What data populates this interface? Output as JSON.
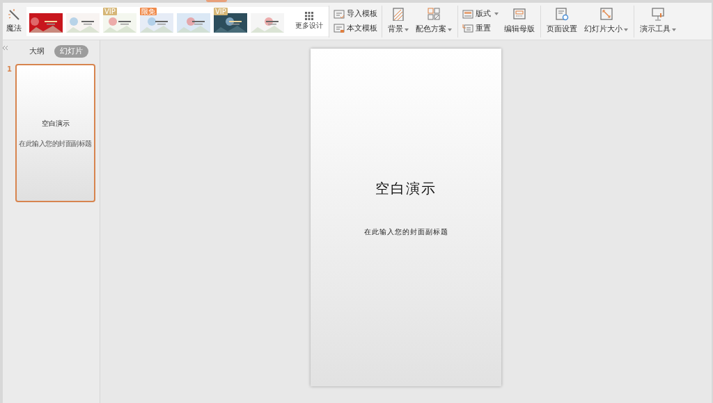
{
  "toolbar": {
    "magic": {
      "label": "魔法"
    },
    "templates": [
      {
        "kind": "picture",
        "color": "#c8161d"
      },
      {
        "kind": "picture",
        "color": "#f8f4f2"
      },
      {
        "kind": "picture",
        "color": "#f4f7ef",
        "badge": "VIP"
      },
      {
        "kind": "picture",
        "color": "#e6ecf6",
        "badge": "限免"
      },
      {
        "kind": "picture",
        "color": "#dbe8f5"
      },
      {
        "kind": "picture",
        "color": "#2d4e5c",
        "badge": "VIP"
      },
      {
        "kind": "picture",
        "color": "#f5f5f5"
      }
    ],
    "more_designs": "更多设计",
    "groups": [
      [
        {
          "kind": "small",
          "label": "导入模板",
          "dropdown": false
        },
        {
          "kind": "small",
          "label": "本文模板",
          "dropdown": false
        }
      ],
      [
        {
          "kind": "large",
          "label": "背景",
          "dropdown": true
        },
        {
          "kind": "large",
          "label": "配色方案",
          "dropdown": true
        }
      ],
      [
        {
          "kind": "small",
          "label": "版式",
          "dropdown": true
        },
        {
          "kind": "small",
          "label": "重置",
          "dropdown": false
        },
        {
          "kind": "large",
          "label": "编辑母版",
          "dropdown": false
        }
      ],
      [
        {
          "kind": "large",
          "label": "页面设置",
          "dropdown": false
        },
        {
          "kind": "large",
          "label": "幻灯片大小",
          "dropdown": true
        }
      ],
      [
        {
          "kind": "large",
          "label": "演示工具",
          "dropdown": true
        }
      ]
    ]
  },
  "sidebar": {
    "tabs": [
      {
        "label": "大纲",
        "selected": false
      },
      {
        "label": "幻灯片",
        "selected": true
      }
    ],
    "slides": [
      {
        "number": "1",
        "title": "空白演示",
        "subtitle": "在此输入您的封面副标题",
        "selected": true
      }
    ]
  },
  "slide": {
    "title": "空白演示",
    "subtitle": "在此输入您的封面副标题"
  }
}
